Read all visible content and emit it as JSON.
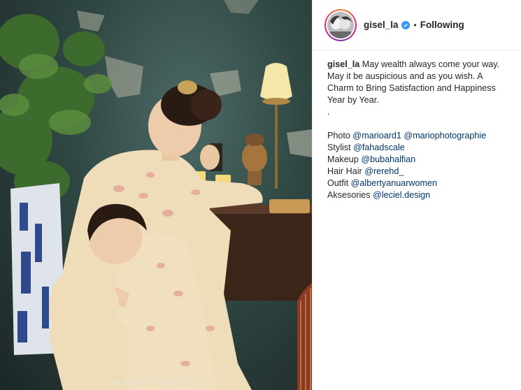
{
  "post": {
    "photo": {
      "watermark_bold": "MARIO",
      "watermark_rest": "PHOTOGRAPHIE"
    },
    "header": {
      "username": "gisel_la",
      "verified_icon": "verified-badge-icon",
      "separator": "•",
      "follow_status": "Following"
    },
    "caption": {
      "username": "gisel_la",
      "lines": [
        "May wealth always come your way.",
        "May it be auspicious and as you wish. A",
        "Charm to Bring Satisfaction and Happiness",
        "Year by Year."
      ],
      "dot_line": ".",
      "credits": [
        {
          "label": "Photo",
          "mentions": [
            "@marioard1",
            "@mariophotographie"
          ]
        },
        {
          "label": "Stylist",
          "mentions": [
            "@fahadscale"
          ]
        },
        {
          "label": "Makeup",
          "mentions": [
            "@bubahalfian"
          ]
        },
        {
          "label": "Hair Hair",
          "mentions": [
            "@rerehd_"
          ]
        },
        {
          "label": "Outfit",
          "mentions": [
            "@albertyanuarwomen"
          ]
        },
        {
          "label": "Aksesories",
          "mentions": [
            "@leciel.design"
          ]
        }
      ]
    },
    "colors": {
      "link": "#003569",
      "text": "#262626",
      "verified": "#3897f0"
    }
  }
}
